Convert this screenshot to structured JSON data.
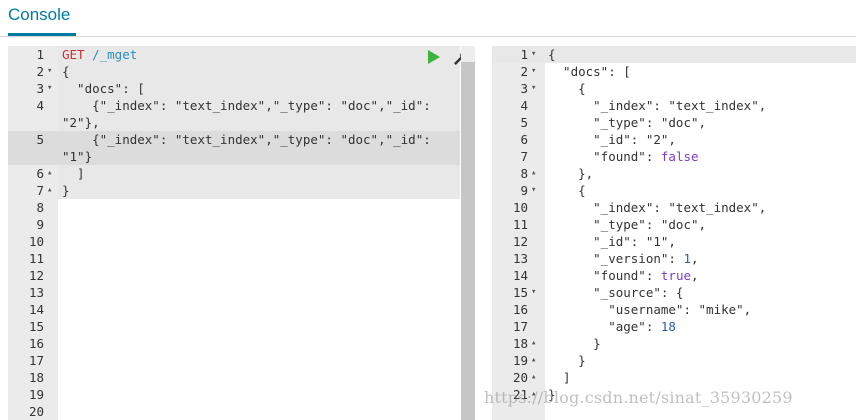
{
  "header": {
    "tab_label": "Console"
  },
  "request": {
    "lines": [
      {
        "n": "1",
        "fold": "",
        "segments": [
          {
            "t": "GET",
            "c": "t-method"
          },
          {
            "t": " ",
            "c": ""
          },
          {
            "t": "/_mget",
            "c": "t-url"
          }
        ]
      },
      {
        "n": "2",
        "fold": "▾",
        "segments": [
          {
            "t": "{",
            "c": "t-str"
          }
        ]
      },
      {
        "n": "3",
        "fold": "▾",
        "segments": [
          {
            "t": "  \"docs\": [",
            "c": "t-str"
          }
        ]
      },
      {
        "n": "4",
        "fold": "",
        "segments": [
          {
            "t": "    {\"_index\": \"text_index\",\"_type\": \"doc\",\"_id\":",
            "c": "t-str"
          }
        ]
      },
      {
        "n": "",
        "fold": "",
        "segments": [
          {
            "t": "\"2\"},",
            "c": "t-str"
          }
        ]
      },
      {
        "n": "5",
        "fold": "",
        "segments": [
          {
            "t": "    {\"_index\": \"text_index\",\"_type\": \"doc\",\"_id\":",
            "c": "t-str"
          }
        ]
      },
      {
        "n": "",
        "fold": "",
        "segments": [
          {
            "t": "\"1\"}",
            "c": "t-str"
          }
        ]
      },
      {
        "n": "6",
        "fold": "▴",
        "segments": [
          {
            "t": "  ]",
            "c": "t-str"
          }
        ]
      },
      {
        "n": "7",
        "fold": "▴",
        "segments": [
          {
            "t": "}",
            "c": "t-str"
          }
        ]
      },
      {
        "n": "8",
        "fold": "",
        "segments": []
      },
      {
        "n": "9",
        "fold": "",
        "segments": []
      },
      {
        "n": "10",
        "fold": "",
        "segments": []
      },
      {
        "n": "11",
        "fold": "",
        "segments": []
      },
      {
        "n": "12",
        "fold": "",
        "segments": []
      },
      {
        "n": "13",
        "fold": "",
        "segments": []
      },
      {
        "n": "14",
        "fold": "",
        "segments": []
      },
      {
        "n": "15",
        "fold": "",
        "segments": []
      },
      {
        "n": "16",
        "fold": "",
        "segments": []
      },
      {
        "n": "17",
        "fold": "",
        "segments": []
      },
      {
        "n": "18",
        "fold": "",
        "segments": []
      },
      {
        "n": "19",
        "fold": "",
        "segments": []
      },
      {
        "n": "20",
        "fold": "",
        "segments": []
      }
    ]
  },
  "response": {
    "lines": [
      {
        "n": "1",
        "fold": "▾",
        "segments": [
          {
            "t": "{",
            "c": "t-str"
          }
        ]
      },
      {
        "n": "2",
        "fold": "▾",
        "segments": [
          {
            "t": "  \"docs\": [",
            "c": "t-str"
          }
        ]
      },
      {
        "n": "3",
        "fold": "▾",
        "segments": [
          {
            "t": "    {",
            "c": "t-str"
          }
        ]
      },
      {
        "n": "4",
        "fold": "",
        "segments": [
          {
            "t": "      \"_index\": \"text_index\",",
            "c": "t-str"
          }
        ]
      },
      {
        "n": "5",
        "fold": "",
        "segments": [
          {
            "t": "      \"_type\": \"doc\",",
            "c": "t-str"
          }
        ]
      },
      {
        "n": "6",
        "fold": "",
        "segments": [
          {
            "t": "      \"_id\": \"2\",",
            "c": "t-str"
          }
        ]
      },
      {
        "n": "7",
        "fold": "",
        "segments": [
          {
            "t": "      \"found\": ",
            "c": "t-str"
          },
          {
            "t": "false",
            "c": "t-kw"
          }
        ]
      },
      {
        "n": "8",
        "fold": "▴",
        "segments": [
          {
            "t": "    },",
            "c": "t-str"
          }
        ]
      },
      {
        "n": "9",
        "fold": "▾",
        "segments": [
          {
            "t": "    {",
            "c": "t-str"
          }
        ]
      },
      {
        "n": "10",
        "fold": "",
        "segments": [
          {
            "t": "      \"_index\": \"text_index\",",
            "c": "t-str"
          }
        ]
      },
      {
        "n": "11",
        "fold": "",
        "segments": [
          {
            "t": "      \"_type\": \"doc\",",
            "c": "t-str"
          }
        ]
      },
      {
        "n": "12",
        "fold": "",
        "segments": [
          {
            "t": "      \"_id\": \"1\",",
            "c": "t-str"
          }
        ]
      },
      {
        "n": "13",
        "fold": "",
        "segments": [
          {
            "t": "      \"_version\": ",
            "c": "t-str"
          },
          {
            "t": "1",
            "c": "t-num"
          },
          {
            "t": ",",
            "c": "t-str"
          }
        ]
      },
      {
        "n": "14",
        "fold": "",
        "segments": [
          {
            "t": "      \"found\": ",
            "c": "t-str"
          },
          {
            "t": "true",
            "c": "t-kw"
          },
          {
            "t": ",",
            "c": "t-str"
          }
        ]
      },
      {
        "n": "15",
        "fold": "▾",
        "segments": [
          {
            "t": "      \"_source\": {",
            "c": "t-str"
          }
        ]
      },
      {
        "n": "16",
        "fold": "",
        "segments": [
          {
            "t": "        \"username\": \"mike\",",
            "c": "t-str"
          }
        ]
      },
      {
        "n": "17",
        "fold": "",
        "segments": [
          {
            "t": "        \"age\": ",
            "c": "t-str"
          },
          {
            "t": "18",
            "c": "t-num"
          }
        ]
      },
      {
        "n": "18",
        "fold": "▴",
        "segments": [
          {
            "t": "      }",
            "c": "t-str"
          }
        ]
      },
      {
        "n": "19",
        "fold": "▴",
        "segments": [
          {
            "t": "    }",
            "c": "t-str"
          }
        ]
      },
      {
        "n": "20",
        "fold": "▴",
        "segments": [
          {
            "t": "  ]",
            "c": "t-str"
          }
        ]
      },
      {
        "n": "21",
        "fold": "▴",
        "segments": [
          {
            "t": "}",
            "c": "t-str"
          }
        ]
      }
    ]
  },
  "toolbar": {
    "run_icon": "play-icon",
    "settings_icon": "wrench-icon"
  },
  "watermark": "https://blog.csdn.net/sinat_35930259"
}
